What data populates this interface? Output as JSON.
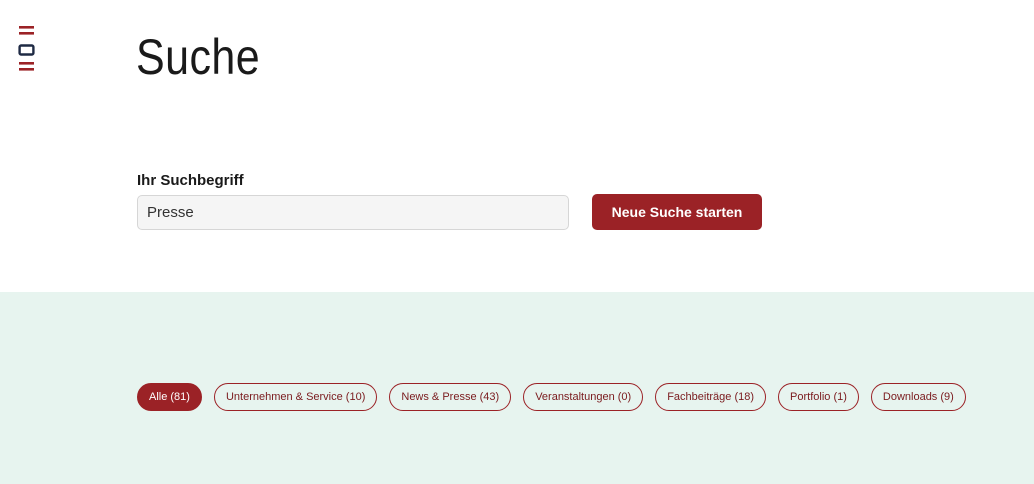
{
  "page": {
    "title": "Suche"
  },
  "logo": {
    "icon": "menu-logo-icon",
    "color": "#9b2226"
  },
  "search": {
    "label": "Ihr Suchbegriff",
    "value": "Presse",
    "placeholder": "",
    "button_label": "Neue Suche starten"
  },
  "filters": [
    {
      "label": "Alle (81)",
      "active": true
    },
    {
      "label": "Unternehmen & Service (10)",
      "active": false
    },
    {
      "label": "News & Presse (43)",
      "active": false
    },
    {
      "label": "Veranstaltungen (0)",
      "active": false
    },
    {
      "label": "Fachbeiträge (18)",
      "active": false
    },
    {
      "label": "Portfolio (1)",
      "active": false
    },
    {
      "label": "Downloads (9)",
      "active": false
    }
  ],
  "colors": {
    "accent": "#9b2226",
    "filter_background": "#e7f4ef",
    "input_background": "#f5f5f5"
  }
}
